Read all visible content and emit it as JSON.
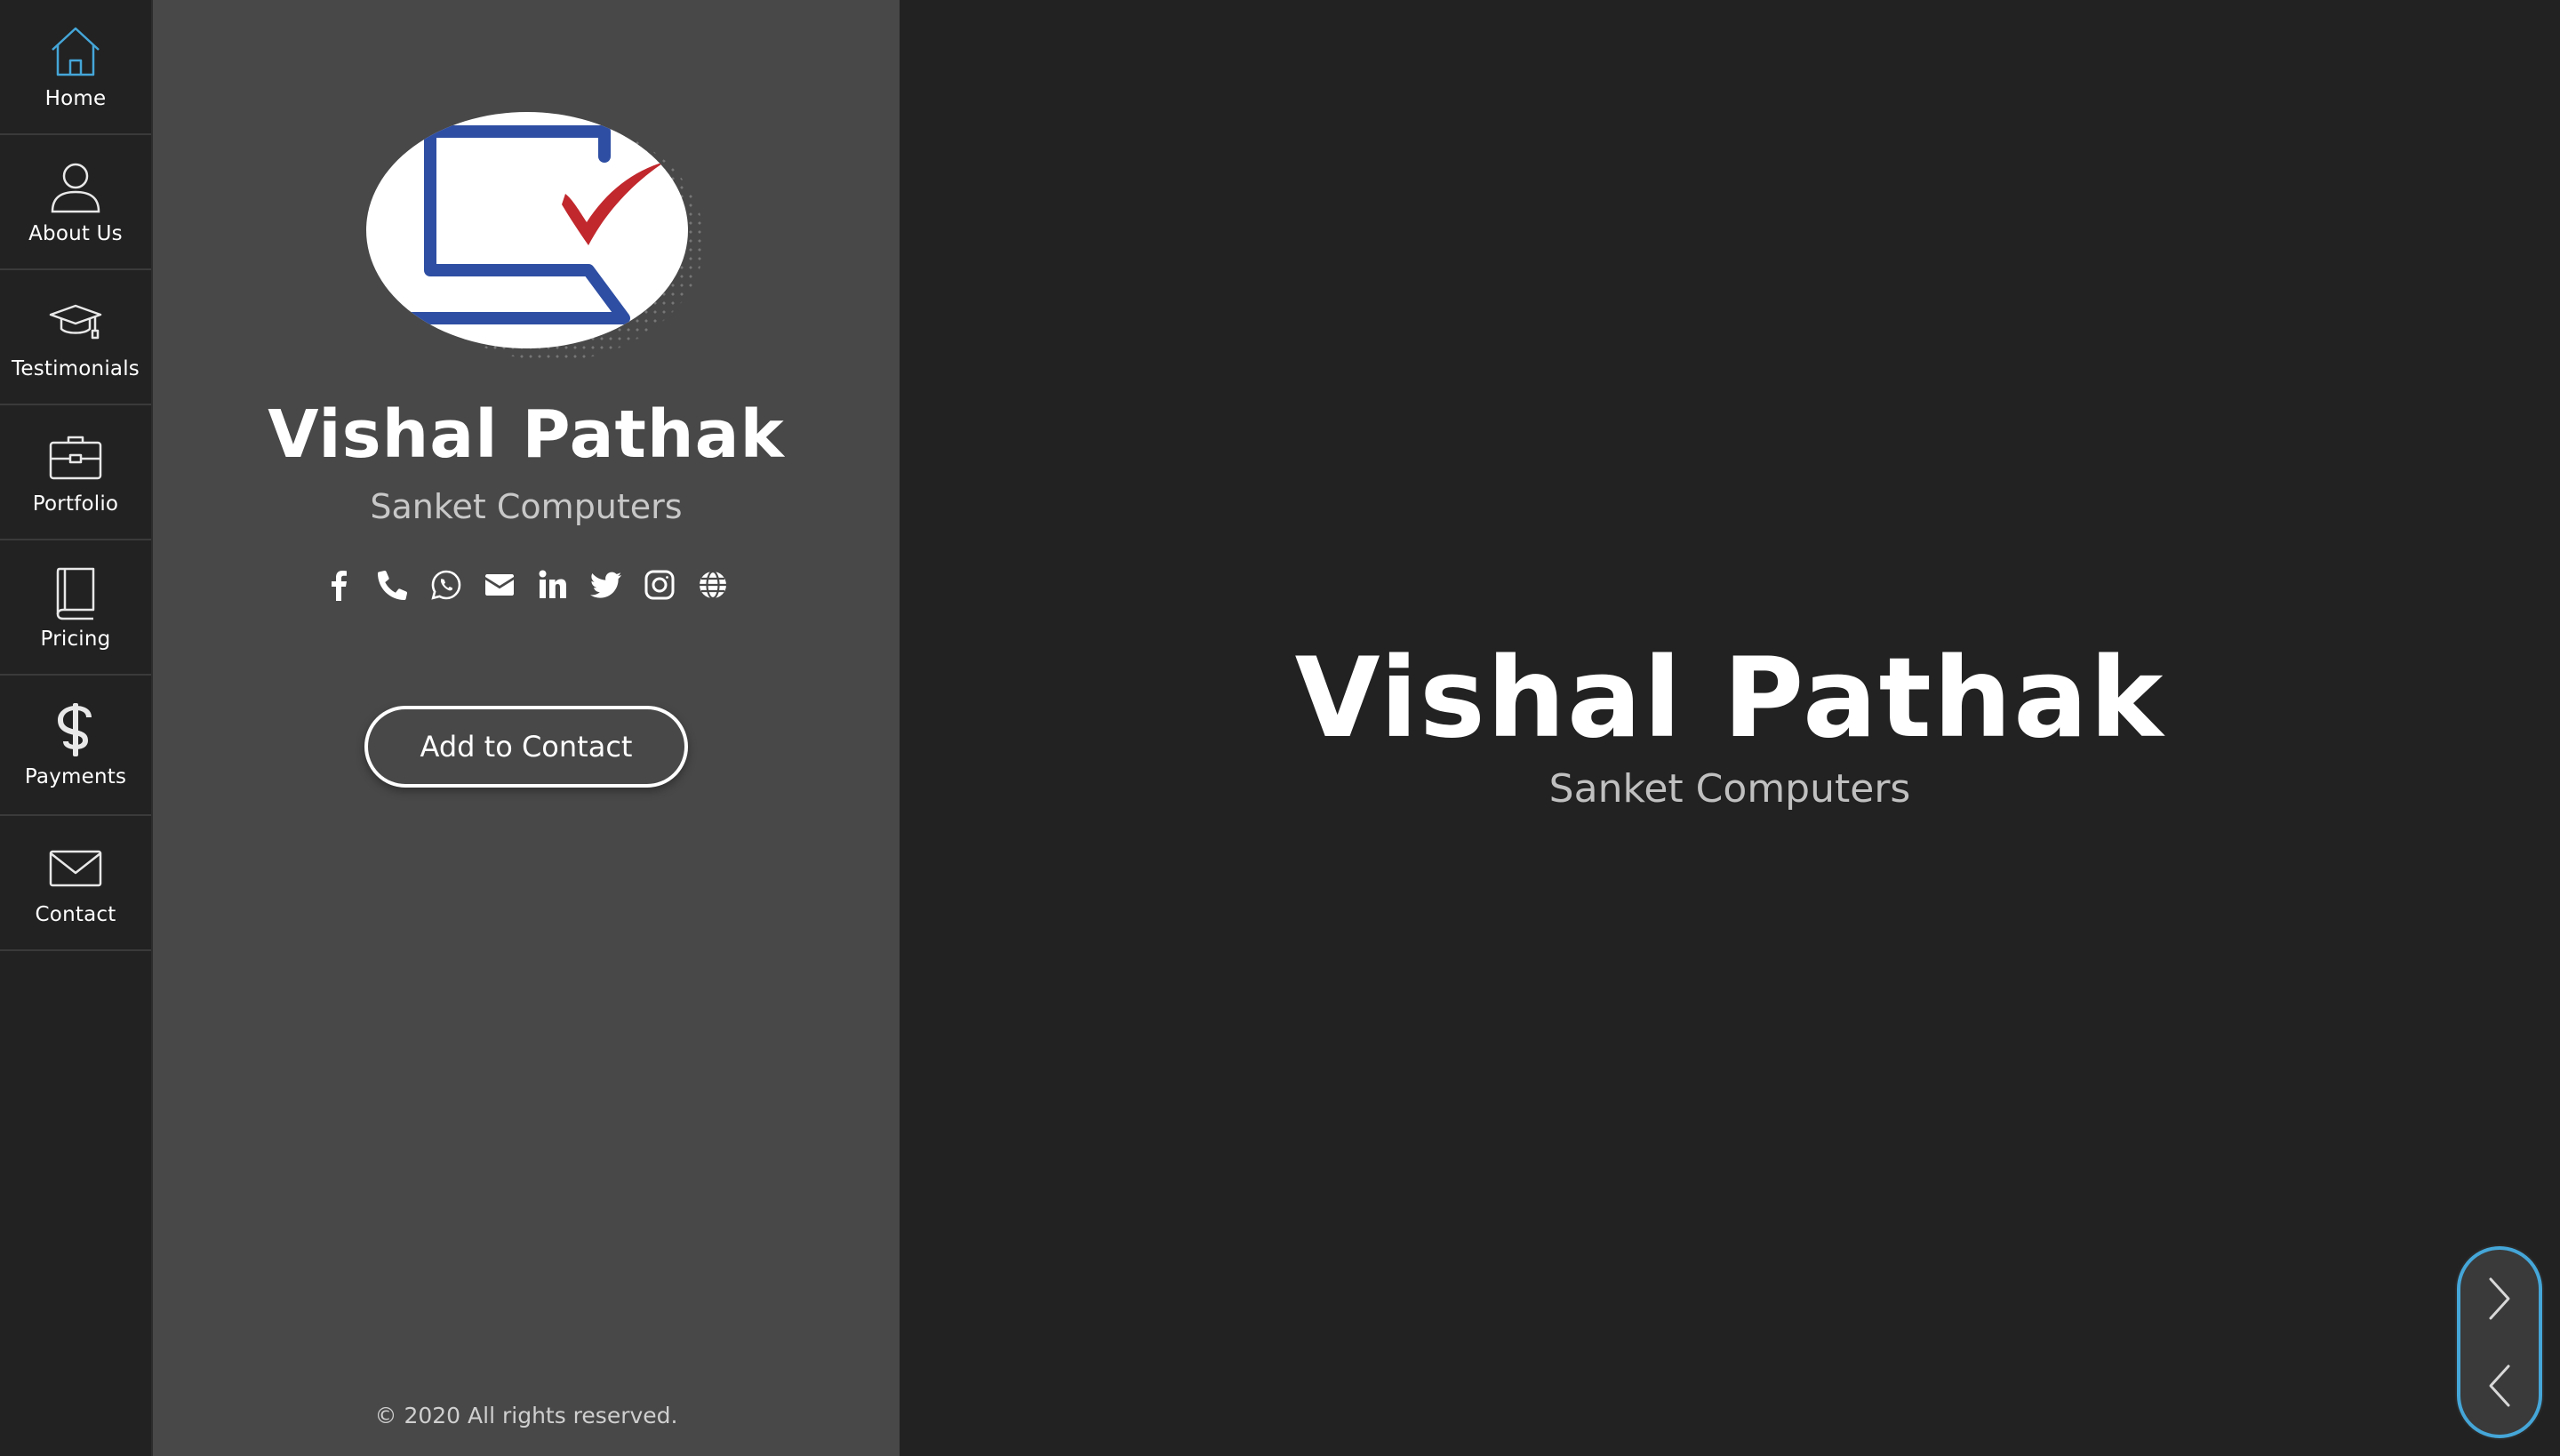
{
  "nav": {
    "items": [
      {
        "label": "Home",
        "icon": "home-icon",
        "color": "#45a6d8"
      },
      {
        "label": "About Us",
        "icon": "user-icon"
      },
      {
        "label": "Testimonials",
        "icon": "graduation-cap-icon"
      },
      {
        "label": "Portfolio",
        "icon": "briefcase-icon"
      },
      {
        "label": "Pricing",
        "icon": "book-icon"
      },
      {
        "label": "Payments",
        "icon": "dollar-icon"
      },
      {
        "label": "Contact",
        "icon": "envelope-icon"
      }
    ]
  },
  "profile": {
    "logo_icon": "laptop-checkmark-logo",
    "name": "Vishal Pathak",
    "company": "Sanket Computers",
    "socials": [
      "facebook-icon",
      "phone-icon",
      "whatsapp-icon",
      "email-icon",
      "linkedin-icon",
      "twitter-icon",
      "instagram-icon",
      "globe-icon"
    ],
    "add_contact_label": "Add to Contact",
    "copyright": "© 2020 All rights reserved."
  },
  "main": {
    "name": "Vishal Pathak",
    "company": "Sanket Computers"
  },
  "pager": {
    "next_icon": "chevron-right-icon",
    "prev_icon": "chevron-left-icon",
    "accent": "#45a6d8"
  },
  "colors": {
    "background": "#222222",
    "panel": "#484848",
    "accent": "#45a6d8"
  }
}
